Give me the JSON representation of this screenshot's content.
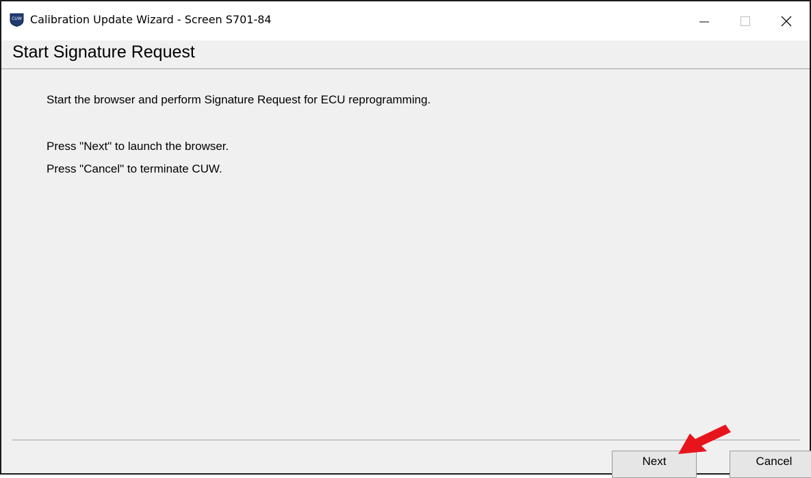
{
  "window": {
    "title": "Calibration Update Wizard - Screen S701-84",
    "icon": "cuw-shield-icon",
    "icon_text": "CUW",
    "controls": {
      "minimize": "minimize-icon",
      "maximize": "maximize-icon",
      "close": "close-icon"
    }
  },
  "header": {
    "title": "Start Signature Request"
  },
  "body": {
    "line1": "Start the browser and perform Signature Request for ECU reprogramming.",
    "line2": "Press \"Next\" to launch the browser.",
    "line3": "Press \"Cancel\" to terminate CUW."
  },
  "footer": {
    "next_label": "Next",
    "cancel_label": "Cancel"
  },
  "annotation": {
    "arrow_color": "#e8141c",
    "points_to": "next-button"
  },
  "colors": {
    "dialog_background": "#f0f0f0",
    "titlebar_background": "#ffffff",
    "accent_arrow": "#e8141c"
  }
}
